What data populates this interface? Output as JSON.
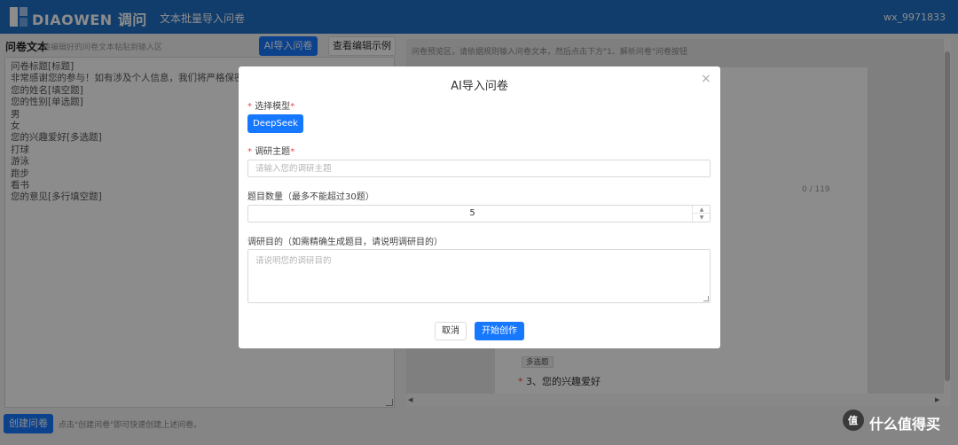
{
  "header": {
    "logo_text": "DIAOWEN 调问",
    "page_title": "文本批量导入问卷",
    "username": "wx_9971833"
  },
  "left_panel": {
    "title": "问卷文本",
    "subtitle": "将编辑好的问卷文本粘贴到输入区",
    "ai_import_label": "AI导入问卷",
    "view_example_label": "查看编辑示例",
    "editor_lines": [
      "问卷标题[标题]",
      "非常感谢您的参与！如有涉及个人信息，我们将严格保密。[副标题]",
      "您的姓名[填空题]",
      "您的性别[单选题]",
      "男",
      "女",
      "您的兴趣爱好[多选题]",
      "打球",
      "游泳",
      "跑步",
      "看书",
      "您的意见[多行填空题]"
    ],
    "create_button_label": "创建问卷",
    "create_hint": "点击\"创建问卷\"即可快速创建上述问卷。"
  },
  "right_panel": {
    "hint": "问卷预览区，请依据规则输入问卷文本，然后点击下方\"1、解析问卷\"问卷按钮",
    "char_counter": "0 / 119",
    "question_tag": "多选题",
    "question_required_mark": "*",
    "question_title": "3、您的兴趣爱好"
  },
  "modal": {
    "title": "AI导入问卷",
    "close_glyph": "×",
    "model_label": "选择模型",
    "model_option": "DeepSeek",
    "topic_label": "调研主题",
    "topic_placeholder": "请输入您的调研主题",
    "count_label": "题目数量（最多不能超过30题）",
    "count_value": "5",
    "purpose_label": "调研目的（如需精确生成题目，请说明调研目的）",
    "purpose_placeholder": "请说明您的调研目的",
    "cancel_label": "取消",
    "start_label": "开始创作",
    "required_mark": "*"
  },
  "watermark": {
    "text": "什么值得买",
    "circle_glyph": "值"
  },
  "colors": {
    "header_bg": "#1f6fc5",
    "primary": "#1677ff",
    "required": "#e84a4a"
  }
}
